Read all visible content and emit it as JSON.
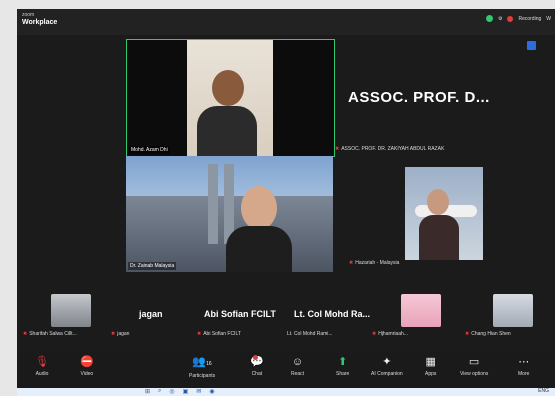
{
  "window": {
    "subtitle": "zoom",
    "title": "Workplace",
    "recording": "Recording",
    "status_extra": "W"
  },
  "tiles": {
    "host_label": "Mohd. Azam Dhi",
    "active_speaker_big": "ASSOC. PROF. D...",
    "active_speaker_sub": "ASSOC. PROF. DR. ZAKIYAH ABDUL RAZAK",
    "t2_label": "Dr. Zainab Malaysia",
    "t3_label": "Hazariah - Malaysia"
  },
  "strip": [
    {
      "label": "Sharifah Salwa Cillt..."
    },
    {
      "big": "jagan",
      "label": "jagan"
    },
    {
      "big": "Abi Sofian FCILT",
      "label": "Abi Sofian FCILT"
    },
    {
      "big": "Lt. Col Mohd Ra...",
      "label": "Lt. Col Mohd Rami..."
    },
    {
      "label": "Hjhamriaah..."
    },
    {
      "label": "Chang Hian Shen"
    }
  ],
  "toolbar": {
    "audio": "Audio",
    "video": "Video",
    "participants": "Participants",
    "participants_count": "16",
    "chat": "Chat",
    "react": "React",
    "share": "Share",
    "ai": "AI Companion",
    "apps": "Apps",
    "view_options": "View options",
    "more": "More"
  },
  "taskbar": {
    "right": "ENG"
  }
}
